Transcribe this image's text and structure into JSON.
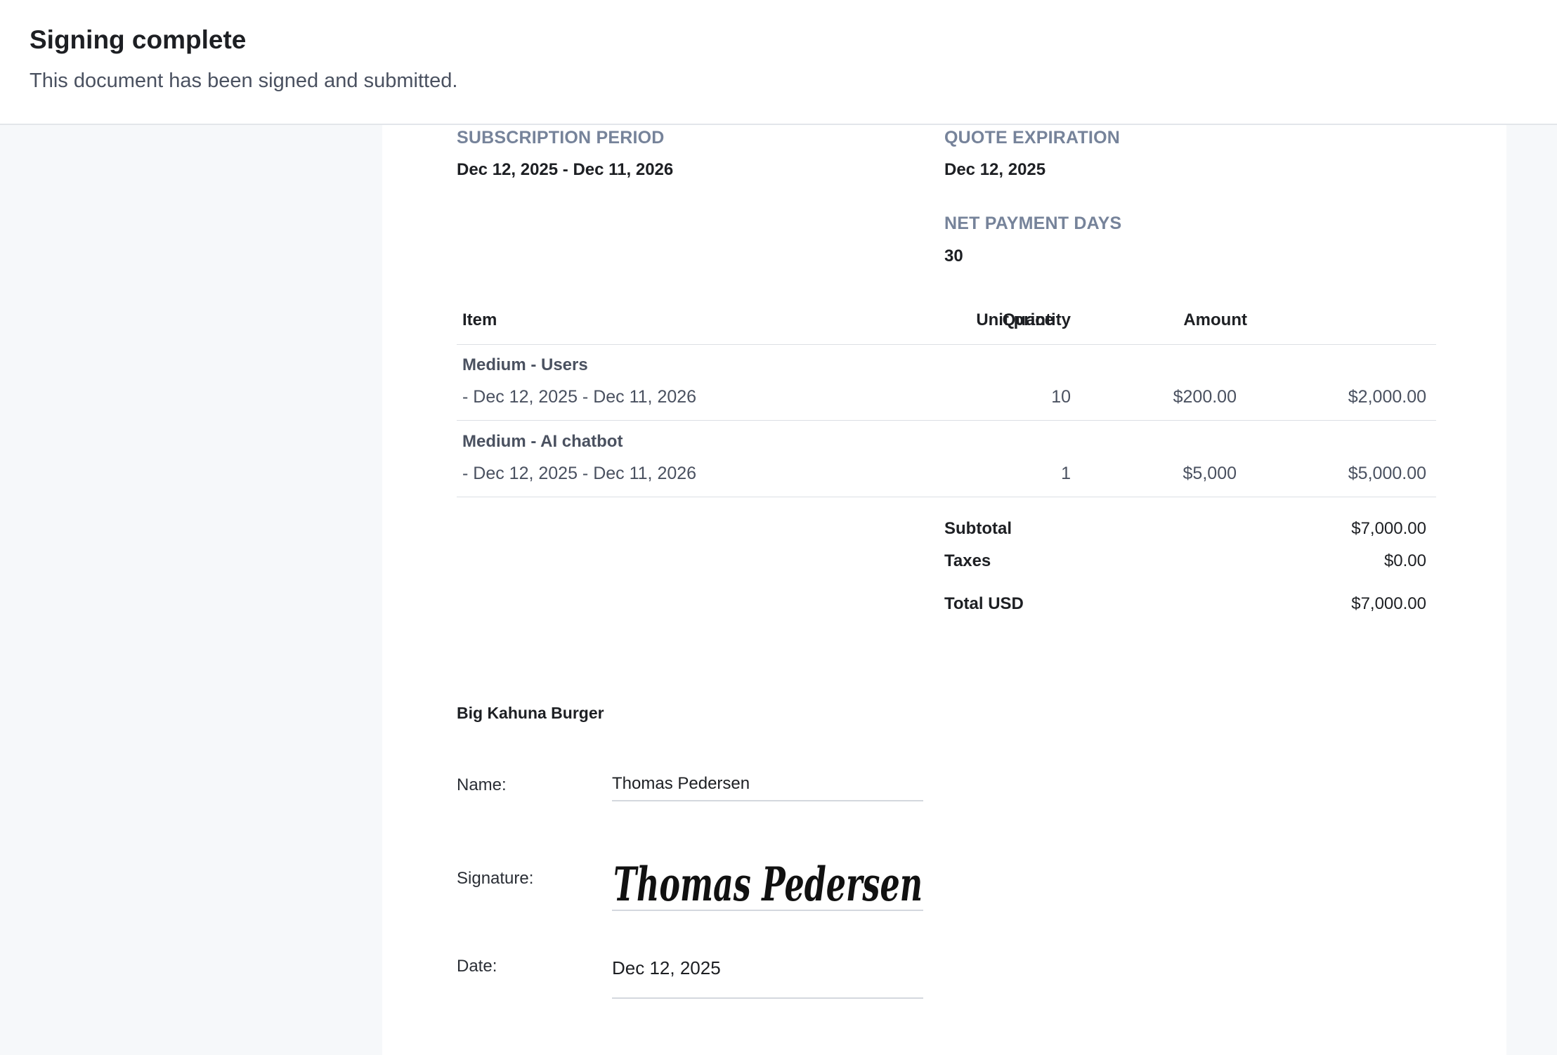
{
  "banner": {
    "title": "Signing complete",
    "subtitle": "This document has been signed and submitted."
  },
  "terms": {
    "subscription_period_label": "SUBSCRIPTION PERIOD",
    "subscription_period_value": "Dec 12, 2025 - Dec 11, 2026",
    "quote_expiration_label": "QUOTE EXPIRATION",
    "quote_expiration_value": "Dec 12, 2025",
    "net_payment_days_label": "NET PAYMENT DAYS",
    "net_payment_days_value": "30"
  },
  "table": {
    "headers": [
      "Item",
      "Quantity",
      "Unit price",
      "Amount"
    ],
    "rows": [
      {
        "name": "Medium - Users",
        "period": "- Dec 12, 2025 - Dec 11, 2026",
        "quantity": "10",
        "unit_price": "$200.00",
        "amount": "$2,000.00"
      },
      {
        "name": "Medium - AI chatbot",
        "period": "- Dec 12, 2025 - Dec 11, 2026",
        "quantity": "1",
        "unit_price": "$5,000",
        "amount": "$5,000.00"
      }
    ]
  },
  "totals": {
    "subtotal_label": "Subtotal",
    "subtotal_value": "$7,000.00",
    "taxes_label": "Taxes",
    "taxes_value": "$0.00",
    "total_label": "Total USD",
    "total_value": "$7,000.00"
  },
  "signature_block": {
    "company": "Big Kahuna Burger",
    "name_label": "Name:",
    "name_value": "Thomas Pedersen",
    "signature_label": "Signature:",
    "signature_text": "Thomas Pedersen",
    "date_label": "Date:",
    "date_value": "Dec 12, 2025"
  }
}
